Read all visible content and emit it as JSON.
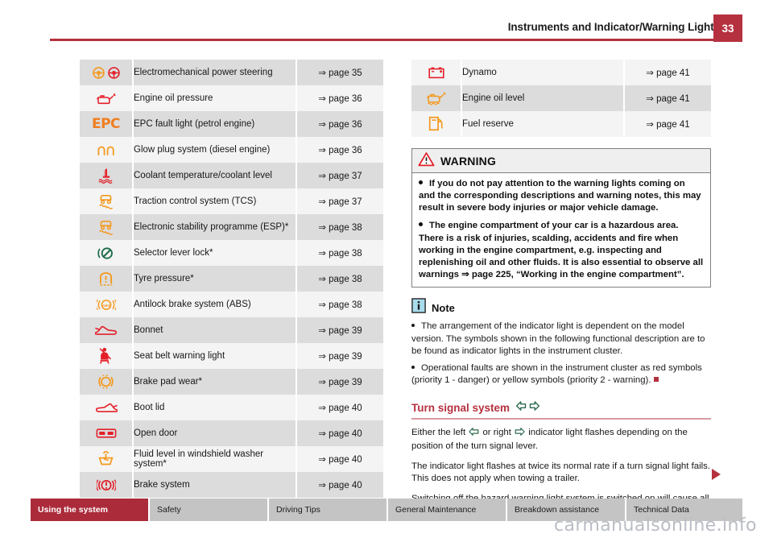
{
  "header": {
    "title": "Instruments and Indicator/Warning Lights",
    "page_number": "33"
  },
  "colors": {
    "brand_red": "#b5313f",
    "icon_orange": "#f07e22",
    "icon_red": "#e8272c",
    "icon_green": "#1e6b4a",
    "row_dark": "#dcdcdc",
    "row_light": "#f4f4f4"
  },
  "left_table": {
    "rows": [
      {
        "icon": "steering-wheel-pair-icon",
        "description": "Electromechanical power steering",
        "page_ref": "⇒ page 35"
      },
      {
        "icon": "oil-pressure-icon",
        "description": "Engine oil pressure",
        "page_ref": "⇒ page 36"
      },
      {
        "icon": "epc-text-icon",
        "icon_text": "EPC",
        "description": "EPC fault light (petrol engine)",
        "page_ref": "⇒ page 36"
      },
      {
        "icon": "glow-plug-icon",
        "description": "Glow plug system (diesel engine)",
        "page_ref": "⇒ page 36"
      },
      {
        "icon": "coolant-temperature-icon",
        "description": "Coolant temperature/coolant level",
        "page_ref": "⇒ page 37"
      },
      {
        "icon": "traction-control-icon",
        "description": "Traction control system (TCS)",
        "page_ref": "⇒ page 37"
      },
      {
        "icon": "esp-icon",
        "description": "Electronic stability programme (ESP)*",
        "page_ref": "⇒ page 38"
      },
      {
        "icon": "selector-lever-lock-icon",
        "description": "Selector lever lock*",
        "page_ref": "⇒ page 38"
      },
      {
        "icon": "tyre-pressure-icon",
        "description": "Tyre pressure*",
        "page_ref": "⇒ page 38"
      },
      {
        "icon": "abs-icon",
        "description": "Antilock brake system (ABS)",
        "page_ref": "⇒ page 38"
      },
      {
        "icon": "bonnet-icon",
        "description": "Bonnet",
        "page_ref": "⇒ page 39"
      },
      {
        "icon": "seat-belt-icon",
        "description": "Seat belt warning light",
        "page_ref": "⇒ page 39"
      },
      {
        "icon": "brake-pad-wear-icon",
        "description": "Brake pad wear*",
        "page_ref": "⇒ page 39"
      },
      {
        "icon": "boot-lid-icon",
        "description": "Boot lid",
        "page_ref": "⇒ page 40"
      },
      {
        "icon": "open-door-icon",
        "description": "Open door",
        "page_ref": "⇒ page 40"
      },
      {
        "icon": "washer-fluid-icon",
        "description": "Fluid level in windshield washer system*",
        "page_ref": "⇒ page 40"
      },
      {
        "icon": "brake-system-icon",
        "description": "Brake system",
        "page_ref": "⇒ page 40"
      }
    ]
  },
  "right_table": {
    "rows": [
      {
        "icon": "dynamo-battery-icon",
        "description": "Dynamo",
        "page_ref": "⇒ page 41"
      },
      {
        "icon": "engine-oil-level-icon",
        "description": "Engine oil level",
        "page_ref": "⇒ page 41"
      },
      {
        "icon": "fuel-reserve-icon",
        "description": "Fuel reserve",
        "page_ref": "⇒ page 41"
      }
    ]
  },
  "warning_box": {
    "title": "WARNING",
    "paragraphs": [
      "If you do not pay attention to the warning lights coming on and the corresponding descriptions and warning notes, this may result in severe body injuries or major vehicle damage.",
      "The engine compartment of your car is a hazardous area. There is a risk of injuries, scalding, accidents and fire when working in the engine compartment, e.g. inspecting and replenishing oil and other fluids. It is also essential to observe all warnings ⇒ page 225, “Working in the engine compartment”."
    ]
  },
  "note_box": {
    "title": "Note",
    "paragraphs": [
      "The arrangement of the indicator light is dependent on the model version. The symbols shown in the following functional description are to be found as indicator lights in the instrument cluster.",
      "Operational faults are shown in the instrument cluster as red symbols (priority 1 - danger) or yellow symbols (priority 2 - warning)."
    ]
  },
  "turn_signal_section": {
    "title": "Turn signal system",
    "paragraph_1_a": "Either the left",
    "paragraph_1_b": "or right",
    "paragraph_1_c": "indicator light flashes depending on the position of the turn signal lever.",
    "paragraph_2": "The indicator light flashes at twice its normal rate if a turn signal light fails. This does not apply when towing a trailer.",
    "paragraph_3": "Switching off the hazard warning light system is switched on will cause all of the turn signal lights as well as both indicator lights to flash."
  },
  "footer": {
    "tabs": [
      {
        "label": "Using the system",
        "active": true
      },
      {
        "label": "Safety",
        "active": false
      },
      {
        "label": "Driving Tips",
        "active": false
      },
      {
        "label": "General Maintenance",
        "active": false
      },
      {
        "label": "Breakdown assistance",
        "active": false
      },
      {
        "label": "Technical Data",
        "active": false
      }
    ]
  },
  "watermark": {
    "text": "carmanualsonline.info"
  }
}
